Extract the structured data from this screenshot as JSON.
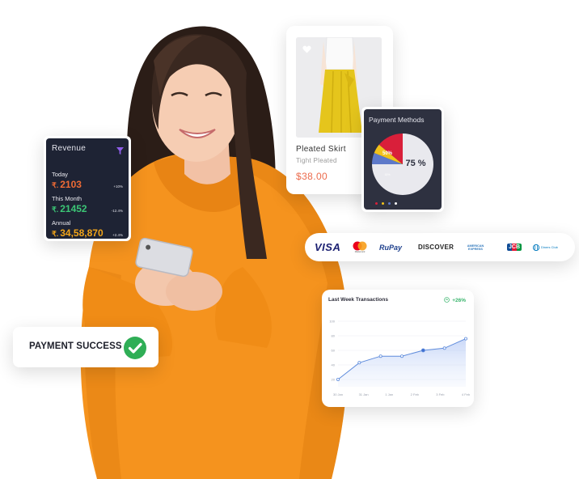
{
  "revenue": {
    "title": "Revenue",
    "currency": "₹.",
    "rows": [
      {
        "label": "Today",
        "value": "2103",
        "change": "+10%",
        "color": "#ef6b35"
      },
      {
        "label": "This Month",
        "value": "21452",
        "change": "-12.4%",
        "color": "#3cc676"
      },
      {
        "label": "Annual",
        "value": "34,58,870",
        "change": "+2.4%",
        "color": "#f2a51a"
      }
    ]
  },
  "product": {
    "name": "Pleated Skirt",
    "subtitle": "Tight Pleated",
    "price": "$38.00",
    "favorite_icon": "heart-icon"
  },
  "payment_methods": {
    "title": "Payment Methods",
    "slices": [
      {
        "label": "75 %",
        "value": 75,
        "color": "#e9e9ee"
      },
      {
        "label": "50%",
        "value": 14,
        "color": "#d91f3a"
      },
      {
        "label": "",
        "value": 5,
        "color": "#f2c21a"
      },
      {
        "label": "15%",
        "value": 6,
        "color": "#5d79c9"
      }
    ],
    "legend_colors": [
      "#d91f3a",
      "#f2c21a",
      "#5d79c9",
      "#ffffff"
    ]
  },
  "card_brands": [
    "VISA",
    "Mastercard",
    "RuPay",
    "DISCOVER",
    "AMERICAN EXPRESS",
    "JCB",
    "Diners Club"
  ],
  "transactions": {
    "title": "Last Week Transactions",
    "change": "+26%",
    "chart_data": {
      "type": "area",
      "categories": [
        "30 Jan",
        "31 Jan",
        "1 Jan",
        "2 Feb",
        "3 Feb",
        "4 Feb"
      ],
      "y_ticks": [
        20,
        40,
        60,
        80,
        100
      ],
      "ylim": [
        10,
        110
      ],
      "values": [
        20,
        43,
        52,
        52,
        60,
        63,
        76
      ],
      "x_positions": [
        0,
        0.5,
        1,
        1.5,
        2,
        2.5,
        3
      ],
      "highlight_index": 4
    }
  },
  "payment_success": {
    "text": "PAYMENT SUCCESS",
    "icon": "check-circle-icon",
    "color": "#2fae56"
  }
}
